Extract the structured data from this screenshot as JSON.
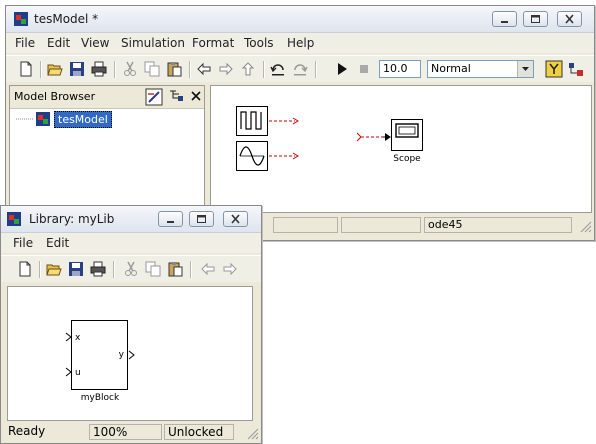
{
  "model_window": {
    "title": "tesModel *",
    "menu": [
      "File",
      "Edit",
      "View",
      "Simulation",
      "Format",
      "Tools",
      "Help"
    ],
    "stop_time": "10.0",
    "sim_mode": "Normal",
    "browser": {
      "title": "Model Browser",
      "tree_item": "tesModel"
    },
    "scope_label": "Scope",
    "status": {
      "solver": "ode45"
    }
  },
  "library_window": {
    "title": "Library: myLib",
    "menu": [
      "File",
      "Edit"
    ],
    "block": {
      "name": "myBlock",
      "in_ports": [
        "x",
        "u"
      ],
      "out_ports": [
        "y"
      ]
    },
    "status": {
      "state": "Ready",
      "zoom": "100%",
      "lock": "Unlocked"
    }
  },
  "colors": {
    "signal_line": "#cc0000",
    "selection": "#316ac5"
  }
}
